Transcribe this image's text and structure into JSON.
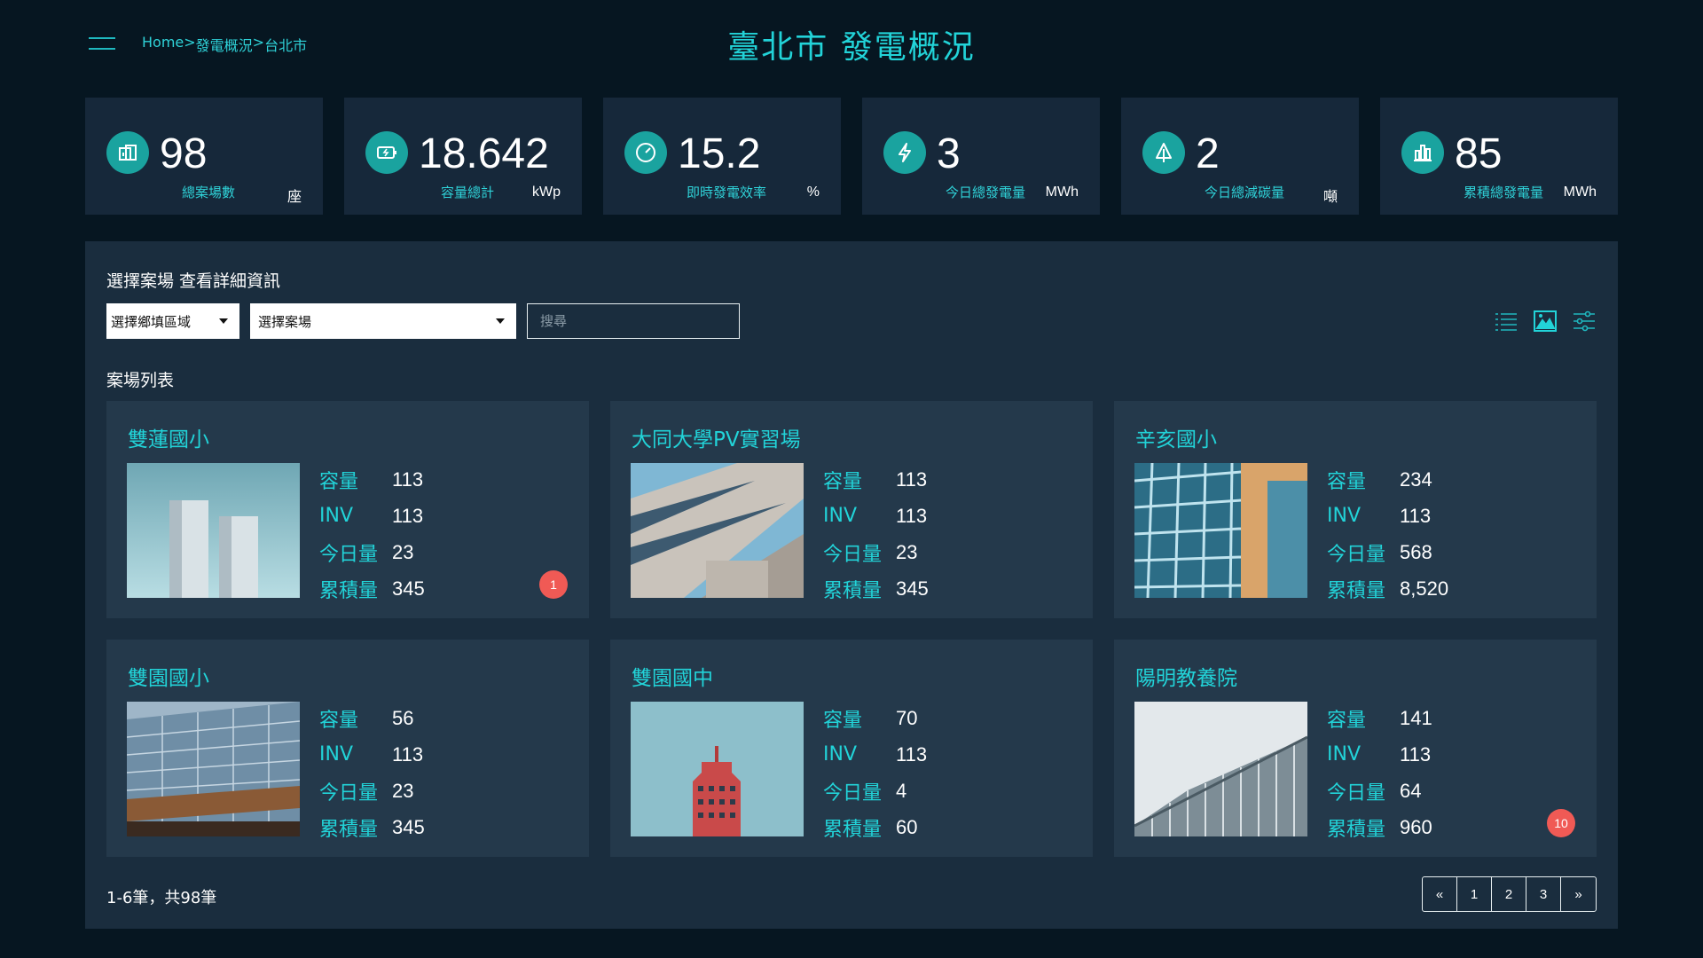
{
  "header": {
    "breadcrumb": [
      "Home",
      ">",
      "發電概況",
      ">",
      "台北市"
    ],
    "title": "臺北市 發電概況"
  },
  "stats": [
    {
      "icon": "building-icon",
      "value": "98",
      "label": "總案場數",
      "unit": "座"
    },
    {
      "icon": "battery-icon",
      "value": "18.642",
      "label": "容量總計",
      "unit": "kWp"
    },
    {
      "icon": "gauge-icon",
      "value": "15.2",
      "label": "即時發電效率",
      "unit": "%"
    },
    {
      "icon": "lightning-icon",
      "value": "3",
      "label": "今日總發電量",
      "unit": "MWh"
    },
    {
      "icon": "tree-icon",
      "value": "2",
      "label": "今日總減碳量",
      "unit": "噸"
    },
    {
      "icon": "bar-chart-icon",
      "value": "85",
      "label": "累積總發電量",
      "unit": "MWh"
    }
  ],
  "filters": {
    "section_title": "選擇案場 查看詳細資訊",
    "district_select": "選擇鄉填區域",
    "site_select": "選擇案場",
    "search_placeholder": "搜尋"
  },
  "view_icons": [
    "list-view-icon",
    "image-view-icon",
    "filter-settings-icon"
  ],
  "list_title": "案場列表",
  "row_labels": {
    "capacity": "容量",
    "inv": "INV",
    "today": "今日量",
    "total": "累積量"
  },
  "sites": [
    {
      "name": "雙蓮國小",
      "capacity": "113",
      "inv": "113",
      "today": "23",
      "total": "345",
      "badge": "1"
    },
    {
      "name": "大同大學PV實習場",
      "capacity": "113",
      "inv": "113",
      "today": "23",
      "total": "345",
      "badge": ""
    },
    {
      "name": "辛亥國小",
      "capacity": "234",
      "inv": "113",
      "today": "568",
      "total": "8,520",
      "badge": ""
    },
    {
      "name": "雙園國小",
      "capacity": "56",
      "inv": "113",
      "today": "23",
      "total": "345",
      "badge": ""
    },
    {
      "name": "雙園國中",
      "capacity": "70",
      "inv": "113",
      "today": "4",
      "total": "60",
      "badge": ""
    },
    {
      "name": "陽明教養院",
      "capacity": "141",
      "inv": "113",
      "today": "64",
      "total": "960",
      "badge": "10"
    }
  ],
  "pagination": {
    "summary": "1-6筆，共98筆",
    "buttons": [
      "«",
      "1",
      "2",
      "3",
      "»"
    ]
  },
  "colors": {
    "accent": "#22d3d8",
    "background": "#061621",
    "card": "#24394b",
    "badge": "#f05a55"
  }
}
